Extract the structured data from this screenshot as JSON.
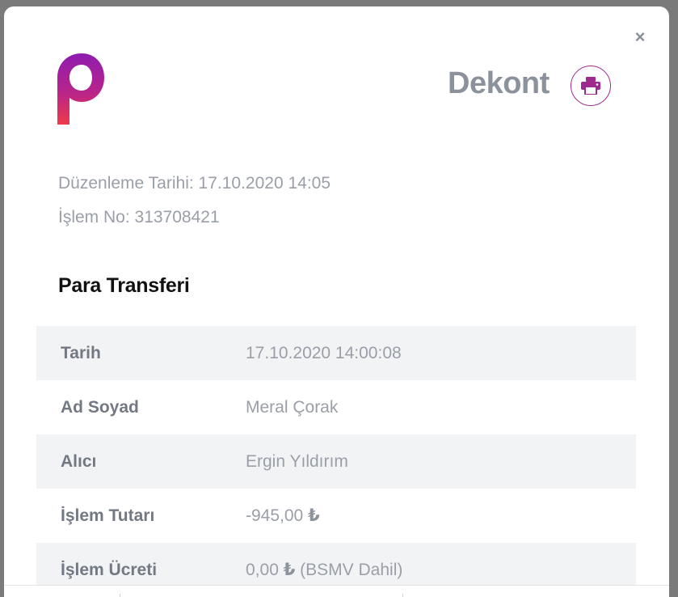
{
  "header": {
    "title": "Dekont",
    "close_glyph": "×",
    "print_icon": "printer-icon",
    "logo": "p",
    "brand_colors": [
      "#9a1fa8",
      "#e8364f"
    ]
  },
  "meta": {
    "issue_date": "Düzenleme Tarihi: 17.10.2020 14:05",
    "transaction_no": "İşlem No: 313708421"
  },
  "section": {
    "title": "Para Transferi"
  },
  "rows": [
    {
      "label": "Tarih",
      "value": "17.10.2020 14:00:08"
    },
    {
      "label": "Ad Soyad",
      "value": "Meral Çorak"
    },
    {
      "label": "Alıcı",
      "value": "Ergin Yıldırım"
    },
    {
      "label": "İşlem Tutarı",
      "value": "-945,00",
      "currency": "₺",
      "suffix": ""
    },
    {
      "label": "İşlem Ücreti",
      "value": "0,00",
      "currency": "₺",
      "suffix": " (BSMV Dahil)"
    }
  ]
}
